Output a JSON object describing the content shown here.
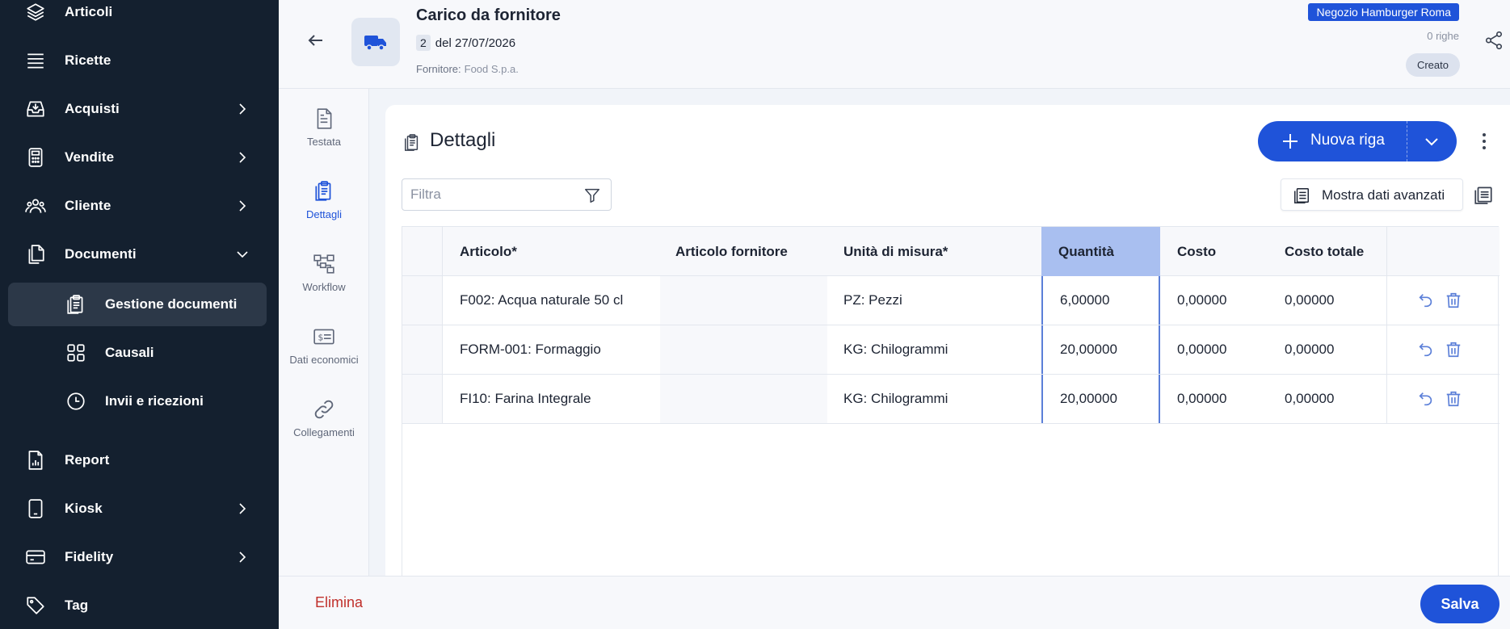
{
  "sidebar": {
    "items": [
      {
        "label": "Articoli",
        "icon": "layers-icon"
      },
      {
        "label": "Ricette",
        "icon": "list-icon"
      },
      {
        "label": "Acquisti",
        "icon": "inbox-icon"
      },
      {
        "label": "Vendite",
        "icon": "calculator-icon"
      },
      {
        "label": "Cliente",
        "icon": "users-icon"
      },
      {
        "label": "Documenti",
        "icon": "documents-icon"
      },
      {
        "label": "Report",
        "icon": "report-icon"
      },
      {
        "label": "Kiosk",
        "icon": "tablet-icon"
      },
      {
        "label": "Fidelity",
        "icon": "card-icon"
      },
      {
        "label": "Tag",
        "icon": "tag-icon"
      }
    ],
    "sub": [
      {
        "label": "Gestione documenti",
        "icon": "clipboard-icon"
      },
      {
        "label": "Causali",
        "icon": "grid-icon"
      },
      {
        "label": "Invii e ricezioni",
        "icon": "clock-icon"
      }
    ]
  },
  "header": {
    "title": "Carico da fornitore",
    "number": "2",
    "date": "del 27/07/2026",
    "supplier_label": "Fornitore:",
    "supplier_value": "Food S.p.a.",
    "store": "Negozio Hamburger Roma",
    "rows_count": "0 righe",
    "status": "Creato"
  },
  "rail": {
    "items": [
      {
        "label": "Testata"
      },
      {
        "label": "Dettagli"
      },
      {
        "label": "Workflow"
      },
      {
        "label": "Dati economici"
      },
      {
        "label": "Collegamenti"
      }
    ]
  },
  "details": {
    "title": "Dettagli",
    "new_row_label": "Nuova riga",
    "filter_placeholder": "Filtra",
    "advanced_label": "Mostra dati avanzati",
    "columns": [
      "Articolo*",
      "Articolo fornitore",
      "Unità di misura*",
      "Quantità",
      "Costo",
      "Costo totale"
    ],
    "rows": [
      {
        "article": "F002: Acqua naturale 50 cl",
        "supplier_article": "",
        "unit": "PZ: Pezzi",
        "qty": "6,00000",
        "cost": "0,00000",
        "total": "0,00000"
      },
      {
        "article": "FORM-001: Formaggio",
        "supplier_article": "",
        "unit": "KG: Chilogrammi",
        "qty": "20,00000",
        "cost": "0,00000",
        "total": "0,00000"
      },
      {
        "article": "FI10: Farina Integrale",
        "supplier_article": "",
        "unit": "KG: Chilogrammi",
        "qty": "20,00000",
        "cost": "0,00000",
        "total": "0,00000"
      }
    ]
  },
  "footer": {
    "delete_label": "Elimina",
    "save_label": "Salva"
  },
  "colors": {
    "sidebar_bg": "#14202f",
    "accent": "#1f53d9",
    "highlight_col": "#a9bff0",
    "danger": "#c0302b"
  }
}
